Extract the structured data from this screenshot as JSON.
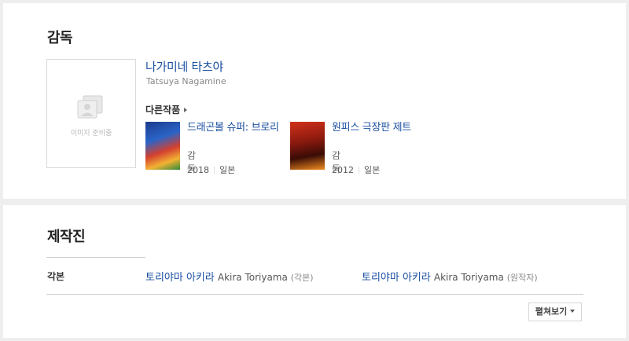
{
  "director_section": {
    "title": "감독",
    "photo_placeholder": "이미지 준비중",
    "name": "나가미네 타츠야",
    "name_en": "Tatsuya Nagamine",
    "other_works_label": "다른작품",
    "works": [
      {
        "title": "드래곤볼 슈퍼: 브로리",
        "role": "감독",
        "year": "2018",
        "country": "일본"
      },
      {
        "title": "원피스 극장판 제트",
        "role": "감독",
        "year": "2012",
        "country": "일본"
      }
    ]
  },
  "crew_section": {
    "title": "제작진",
    "row_label": "각본",
    "members": [
      {
        "name_kr": "토리야마 아키라",
        "name_en": "Akira Toriyama",
        "role": "(각본)"
      },
      {
        "name_kr": "토리야마 아키라",
        "name_en": "Akira Toriyama",
        "role": "(원작자)"
      }
    ],
    "more_label": "펼쳐보기"
  }
}
